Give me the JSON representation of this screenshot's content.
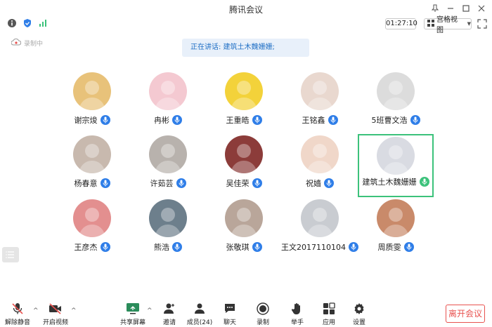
{
  "window": {
    "title": "腾讯会议"
  },
  "toolbar": {
    "timer": "01:27:10",
    "view_label": "宫格视图"
  },
  "recording": {
    "label": "录制中"
  },
  "speaking": {
    "text": "正在讲话: 建筑土木魏姗姗;"
  },
  "participants": [
    {
      "name": "谢宗焌",
      "color": "#e8c27a",
      "mic": "on"
    },
    {
      "name": "冉彬",
      "color": "#f4c9d1",
      "mic": "on"
    },
    {
      "name": "王重皓",
      "color": "#f3d23a",
      "mic": "on"
    },
    {
      "name": "王铭鑫",
      "color": "#e9d8cf",
      "mic": "on"
    },
    {
      "name": "5班曹文浩",
      "color": "#dcdcdc",
      "mic": "on"
    },
    {
      "name": "杨春意",
      "color": "#c8b9ae",
      "mic": "on"
    },
    {
      "name": "许茹芸",
      "color": "#b8b2ad",
      "mic": "on"
    },
    {
      "name": "吴佳荣",
      "color": "#8c3c3a",
      "mic": "on"
    },
    {
      "name": "祝嫱",
      "color": "#f0d7c9",
      "mic": "on"
    },
    {
      "name": "建筑土木魏姗姗",
      "color": "#d9dbe2",
      "mic": "speaking"
    },
    {
      "name": "王彦杰",
      "color": "#e38f8f",
      "mic": "on"
    },
    {
      "name": "熊浩",
      "color": "#6d7f8c",
      "mic": "on"
    },
    {
      "name": "张敬琪",
      "color": "#b9a69a",
      "mic": "on"
    },
    {
      "name": "王文2017110104",
      "color": "#c9ccd1",
      "mic": "on"
    },
    {
      "name": "周质雯",
      "color": "#c98a6a",
      "mic": "on"
    }
  ],
  "bottombar": {
    "unmute": "解除静音",
    "start_video": "开启视频",
    "share_screen": "共享屏幕",
    "invite": "邀请",
    "members": "成员(24)",
    "chat": "聊天",
    "record": "录制",
    "raise_hand": "举手",
    "apps": "应用",
    "settings": "设置",
    "leave": "离开会议"
  },
  "colors": {
    "accent": "#2f7ee8",
    "speaking_border": "#3cc27b",
    "leave": "#e8524f"
  }
}
